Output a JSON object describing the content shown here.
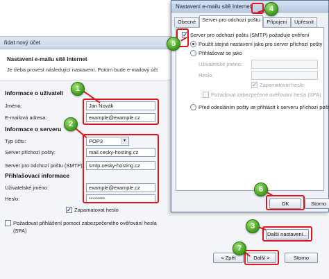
{
  "wizard": {
    "title": "řidat nový účet",
    "header_title": "Nastavení e-mailu sítě Internet",
    "header_subtitle": "Je třeba provést následující nastavení. Potom bude e-mailový účt",
    "user_info": {
      "heading": "Informace o uživateli",
      "name_label": "Jméno:",
      "name_value": "Jan Novák",
      "email_label": "E-mailová adresa:",
      "email_value": "example@example.cz"
    },
    "server_info": {
      "heading": "Informace o serveru",
      "account_type_label": "Typ účtu:",
      "account_type_value": "POP3",
      "incoming_label": "Server příchozí pošty:",
      "incoming_value": "mail.cesky-hosting.cz",
      "outgoing_label": "Server pro odchozí poštu (SMTP):",
      "outgoing_value": "smtp.cesky-hosting.cz"
    },
    "logon_info": {
      "heading": "Přihlašovací informace",
      "username_label": "Uživatelské jméno:",
      "username_value": "example@example.cz",
      "password_label": "Heslo:",
      "password_value": "********",
      "remember_label": "Zapamatovat heslo",
      "spa_label_line1": "Požadovat přihlášení pomocí zabezpečeného ověřování hesla",
      "spa_label_line2": "(SPA)"
    },
    "more_settings_label": "Další nastavení...",
    "back_label": "< Zpět",
    "next_label": "Další >",
    "cancel_label": "Storno"
  },
  "dialog": {
    "title": "Nastavení e-mailu sítě Internet",
    "tabs": [
      {
        "label": "Obecné",
        "active": false
      },
      {
        "label": "Server pro odchozí poštu",
        "active": true
      },
      {
        "label": "Připojení",
        "active": false
      },
      {
        "label": "Upřesnit",
        "active": false
      }
    ],
    "smtp_auth_label": "Server pro odchozí poštu (SMTP) požaduje ověření",
    "same_settings_label": "Použít stejná nastavení jako pro server příchozí pošty",
    "logon_using_label": "Přihlašovat se jako",
    "username_label": "Uživatelské jméno:",
    "password_label": "Heslo:",
    "remember_label": "Zapamatovat heslo",
    "spa_label": "Požadovat zabezpečené ověřování hesla (SPA)",
    "pop_before_smtp_label": "Před odesláním pošty se přihlásit k serveru příchozí pošty",
    "ok_label": "OK",
    "cancel_label": "Storno"
  },
  "badges": [
    "1",
    "2",
    "3",
    "4",
    "5",
    "6",
    "7"
  ],
  "colors": {
    "highlight": "#e0141e",
    "badge": "#3f9a1e"
  }
}
